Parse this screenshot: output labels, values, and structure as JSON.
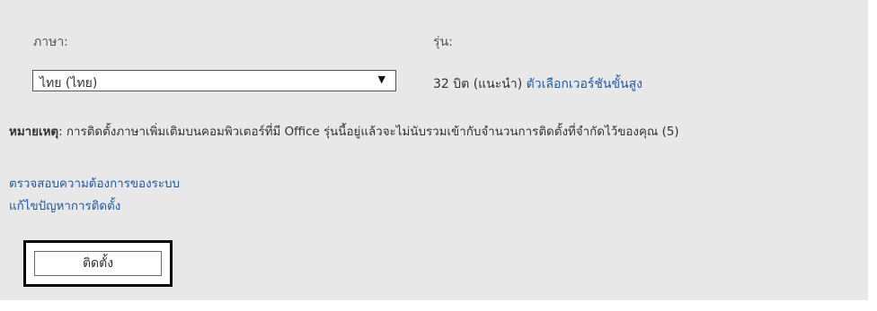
{
  "language": {
    "label": "ภาษา:",
    "selected": "ไทย (ไทย)",
    "arrow_icon": "triangle-down"
  },
  "version": {
    "label": "รุ่น:",
    "bits_text": "32 บิต (แนะนำ)",
    "advanced_link": "ตัวเลือกเวอร์ชันขั้นสูง"
  },
  "note": {
    "prefix": "หมายเหตุ",
    "text": ": การติดตั้งภาษาเพิ่มเติมบนคอมพิวเตอร์ที่มี Office รุ่นนี้อยู่แล้วจะไม่นับรวมเข้ากับจำนวนการติดตั้งที่จำกัดไว้ของคุณ (5)"
  },
  "links": {
    "system_requirements": "ตรวจสอบความต้องการของระบบ",
    "troubleshoot": "แก้ไขปัญหาการติดตั้ง"
  },
  "install_button": "ติดตั้ง",
  "colors": {
    "panel": "#e8e8e8",
    "link": "#1f5aa5",
    "highlight_border": "#000000"
  }
}
